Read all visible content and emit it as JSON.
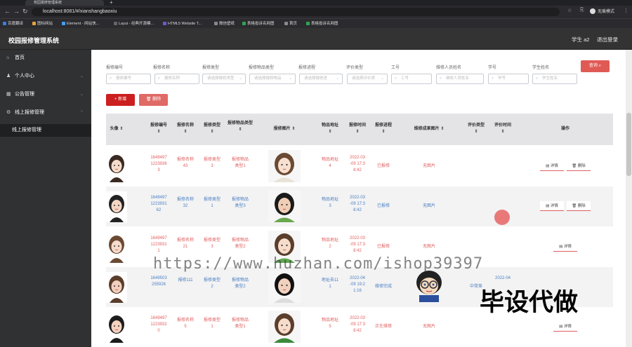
{
  "browser": {
    "tab_title": "校园报修管理系统",
    "url": "localhost:8081/#/xianshangbaoxiu",
    "profile": "无痕模式",
    "bookmarks": [
      "百度翻译",
      "图标网站",
      "Element - 网站快...",
      "Layui - 经典开源模...",
      "HTML5 Website T...",
      "微信壁纸",
      "表格投诉名网图",
      "首页",
      "表格投诉名网图"
    ]
  },
  "app": {
    "title": "校园报修管理系统",
    "user": "学生 a2",
    "logout": "退出登录"
  },
  "sidebar": {
    "items": [
      {
        "label": "首页",
        "icon": "home-icon"
      },
      {
        "label": "个人中心",
        "icon": "user-icon"
      },
      {
        "label": "公告管理",
        "icon": "grid-icon"
      },
      {
        "label": "线上报修管理",
        "icon": "gear-icon"
      },
      {
        "label": "线上报修管理"
      }
    ]
  },
  "filters": {
    "labels": [
      "报修编号",
      "报修名称",
      "报修类型",
      "报修物品类型",
      "报修进程",
      "评价类型",
      "工号",
      "维修人员姓名",
      "学号",
      "学生姓名"
    ],
    "placeholders": [
      "报修编号",
      "报修名称",
      "请选择报修类型",
      "请选择报修物品",
      "请选择报修进",
      "请选择评价类",
      "工号",
      "维修人员姓名",
      "学号",
      "学生姓名"
    ],
    "search_btn": "查询"
  },
  "actions": {
    "add": "新增",
    "delete": "删除"
  },
  "table": {
    "headers": [
      "头像",
      "报修编号",
      "报修名称",
      "报修类型",
      "报修物品类型",
      "报修图片",
      "物品地址",
      "报修时间",
      "报修进程",
      "维修成果图片",
      "评价类型",
      "评价时间",
      "操作"
    ],
    "detail_btn": "详情",
    "delete_btn": "删除",
    "rows": [
      {
        "code": [
          "1649497",
          "1223936",
          "3"
        ],
        "name": [
          "报修名称",
          "43"
        ],
        "type": [
          "报修类型",
          "3"
        ],
        "item": [
          "报修物品",
          "类型1"
        ],
        "addr": [
          "物品地址",
          "4"
        ],
        "time": [
          "2022-03",
          "-09 17:3",
          "8:42"
        ],
        "progress": "已报修",
        "result": "无图片",
        "eval": "",
        "eval_time": "",
        "color": "red"
      },
      {
        "code": [
          "1649497",
          "1223931",
          "62"
        ],
        "name": [
          "报修名称",
          "32"
        ],
        "type": [
          "报修类型",
          "1"
        ],
        "item": [
          "报修物品",
          "类型3"
        ],
        "addr": [
          "物品地址",
          "3"
        ],
        "time": [
          "2022-03",
          "-09 17:3",
          "8:42"
        ],
        "progress": "已报修",
        "result": "无图片",
        "eval": "",
        "eval_time": "",
        "color": "blue"
      },
      {
        "code": [
          "1649497",
          "1223931",
          "1"
        ],
        "name": [
          "报修名称",
          "21"
        ],
        "type": [
          "报修类型",
          "3"
        ],
        "item": [
          "报修物品",
          "类型2"
        ],
        "addr": [
          "物品地址",
          "2"
        ],
        "time": [
          "2022-03",
          "-09 17:3",
          "8:42"
        ],
        "progress": "已报修",
        "result": "无图片",
        "eval": "",
        "eval_time": "",
        "color": "red"
      },
      {
        "code": [
          "1649503",
          "255926",
          ""
        ],
        "name": [
          "报修111",
          ""
        ],
        "type": [
          "报修类型",
          "2"
        ],
        "item": [
          "报修物品",
          "类型2"
        ],
        "addr": [
          "地址去11",
          "1"
        ],
        "time": [
          "2022-04",
          "-09 19:2",
          "1:16"
        ],
        "progress": "维修完成",
        "result": "",
        "eval": "中常差",
        "eval_time": "2022-04",
        "color": "blue"
      },
      {
        "code": [
          "1649497",
          "1223932",
          "0"
        ],
        "name": [
          "报修名称",
          "5"
        ],
        "type": [
          "报修类型",
          "1"
        ],
        "item": [
          "报修物品",
          "类型1"
        ],
        "addr": [
          "物品地址",
          "5"
        ],
        "time": [
          "2022-03",
          "-09 17:3",
          "8:42"
        ],
        "progress": "正在维修",
        "result": "无图片",
        "eval": "",
        "eval_time": "",
        "color": "red"
      }
    ]
  },
  "watermark": "https://www.huzhan.com/ishop39397",
  "stamp": "毕设代做",
  "colors": {
    "accent_red": "#d9363e",
    "link_blue": "#4a7fc0",
    "header_bg": "#333333",
    "sidebar_bg": "#303133"
  }
}
